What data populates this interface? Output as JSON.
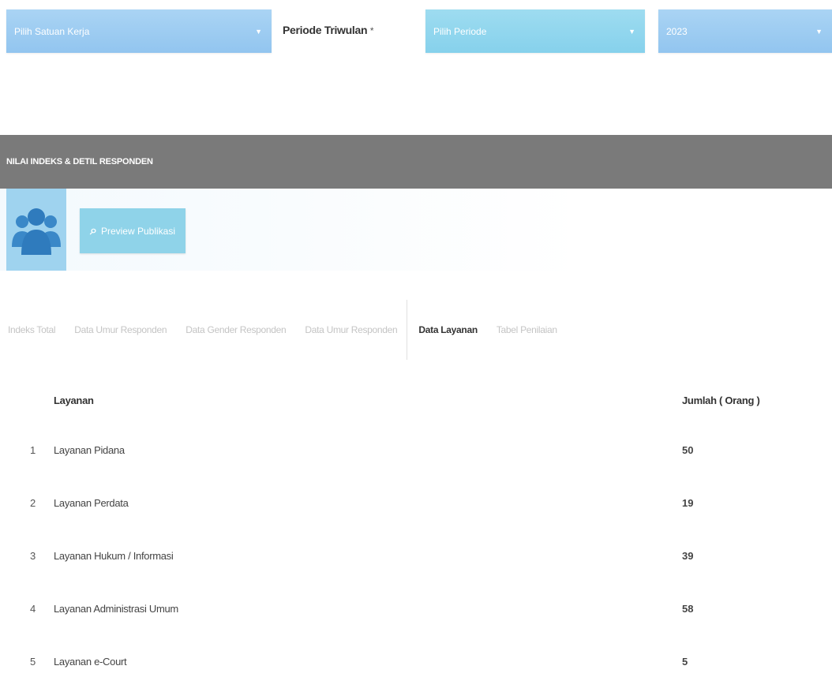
{
  "filters": {
    "satuan_kerja": "Pilih Satuan Kerja",
    "periode_label": "Periode Triwulan",
    "periode_required": "*",
    "periode": "Pilih Periode",
    "tahun": "2023",
    "caret": "▼"
  },
  "panel": {
    "title": "NILAI INDEKS & DETIL RESPONDEN",
    "preview_button": "Preview Publikasi",
    "icons": {
      "users": "users-group-icon",
      "search": "search-icon"
    }
  },
  "tabs": [
    {
      "label": "Indeks Total"
    },
    {
      "label": "Data Umur Responden"
    },
    {
      "label": "Data Gender Responden"
    },
    {
      "label": "Data Umur Responden"
    },
    {
      "label": "Data Layanan"
    },
    {
      "label": "Tabel Penilaian"
    }
  ],
  "table": {
    "headers": {
      "name": "Layanan",
      "count": "Jumlah ( Orang )"
    },
    "rows": [
      {
        "no": "1",
        "name": "Layanan Pidana",
        "count": "50"
      },
      {
        "no": "2",
        "name": "Layanan Perdata",
        "count": "19"
      },
      {
        "no": "3",
        "name": "Layanan Hukum / Informasi",
        "count": "39"
      },
      {
        "no": "4",
        "name": "Layanan Administrasi Umum",
        "count": "58"
      },
      {
        "no": "5",
        "name": "Layanan e-Court",
        "count": "5"
      }
    ]
  },
  "colors": {
    "select_bg": "#92c5ef",
    "periode_bg": "#86d1ec",
    "panel_header_bg": "#7a7a7a",
    "accent_button": "#8fd3e9"
  }
}
